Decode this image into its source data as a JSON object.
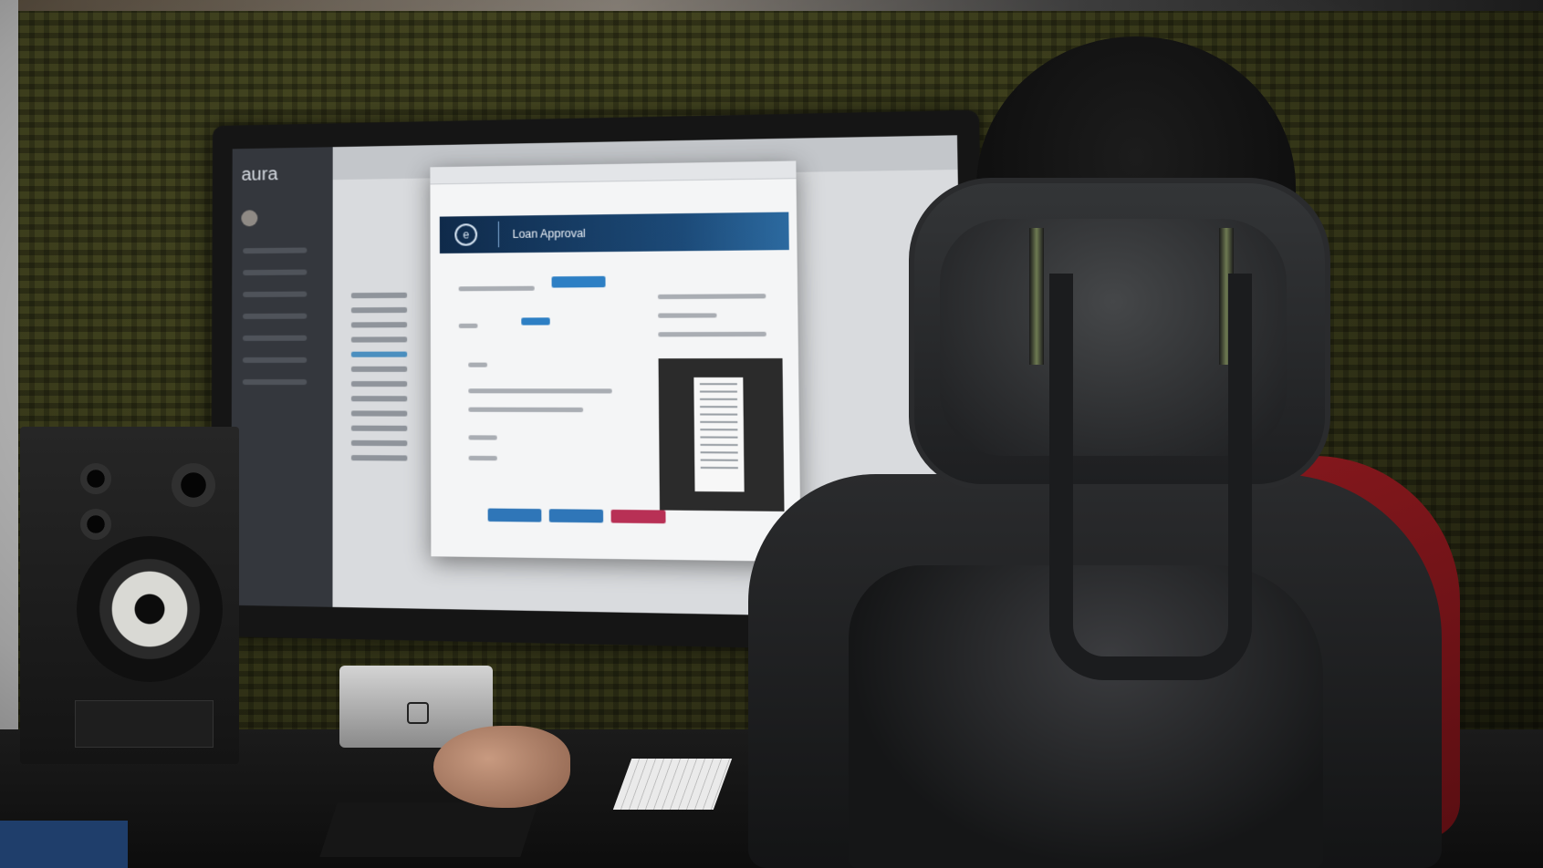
{
  "scene": {
    "description_free": true
  },
  "monitor_app": {
    "logo_text": "aura",
    "dialog_title": "Loan Approval"
  },
  "colors": {
    "wall": "#4a4c22",
    "banner": "#1c4a78",
    "button_blue": "#2f76b8",
    "button_red": "#b83055",
    "shirt": "#8f1a1f"
  }
}
